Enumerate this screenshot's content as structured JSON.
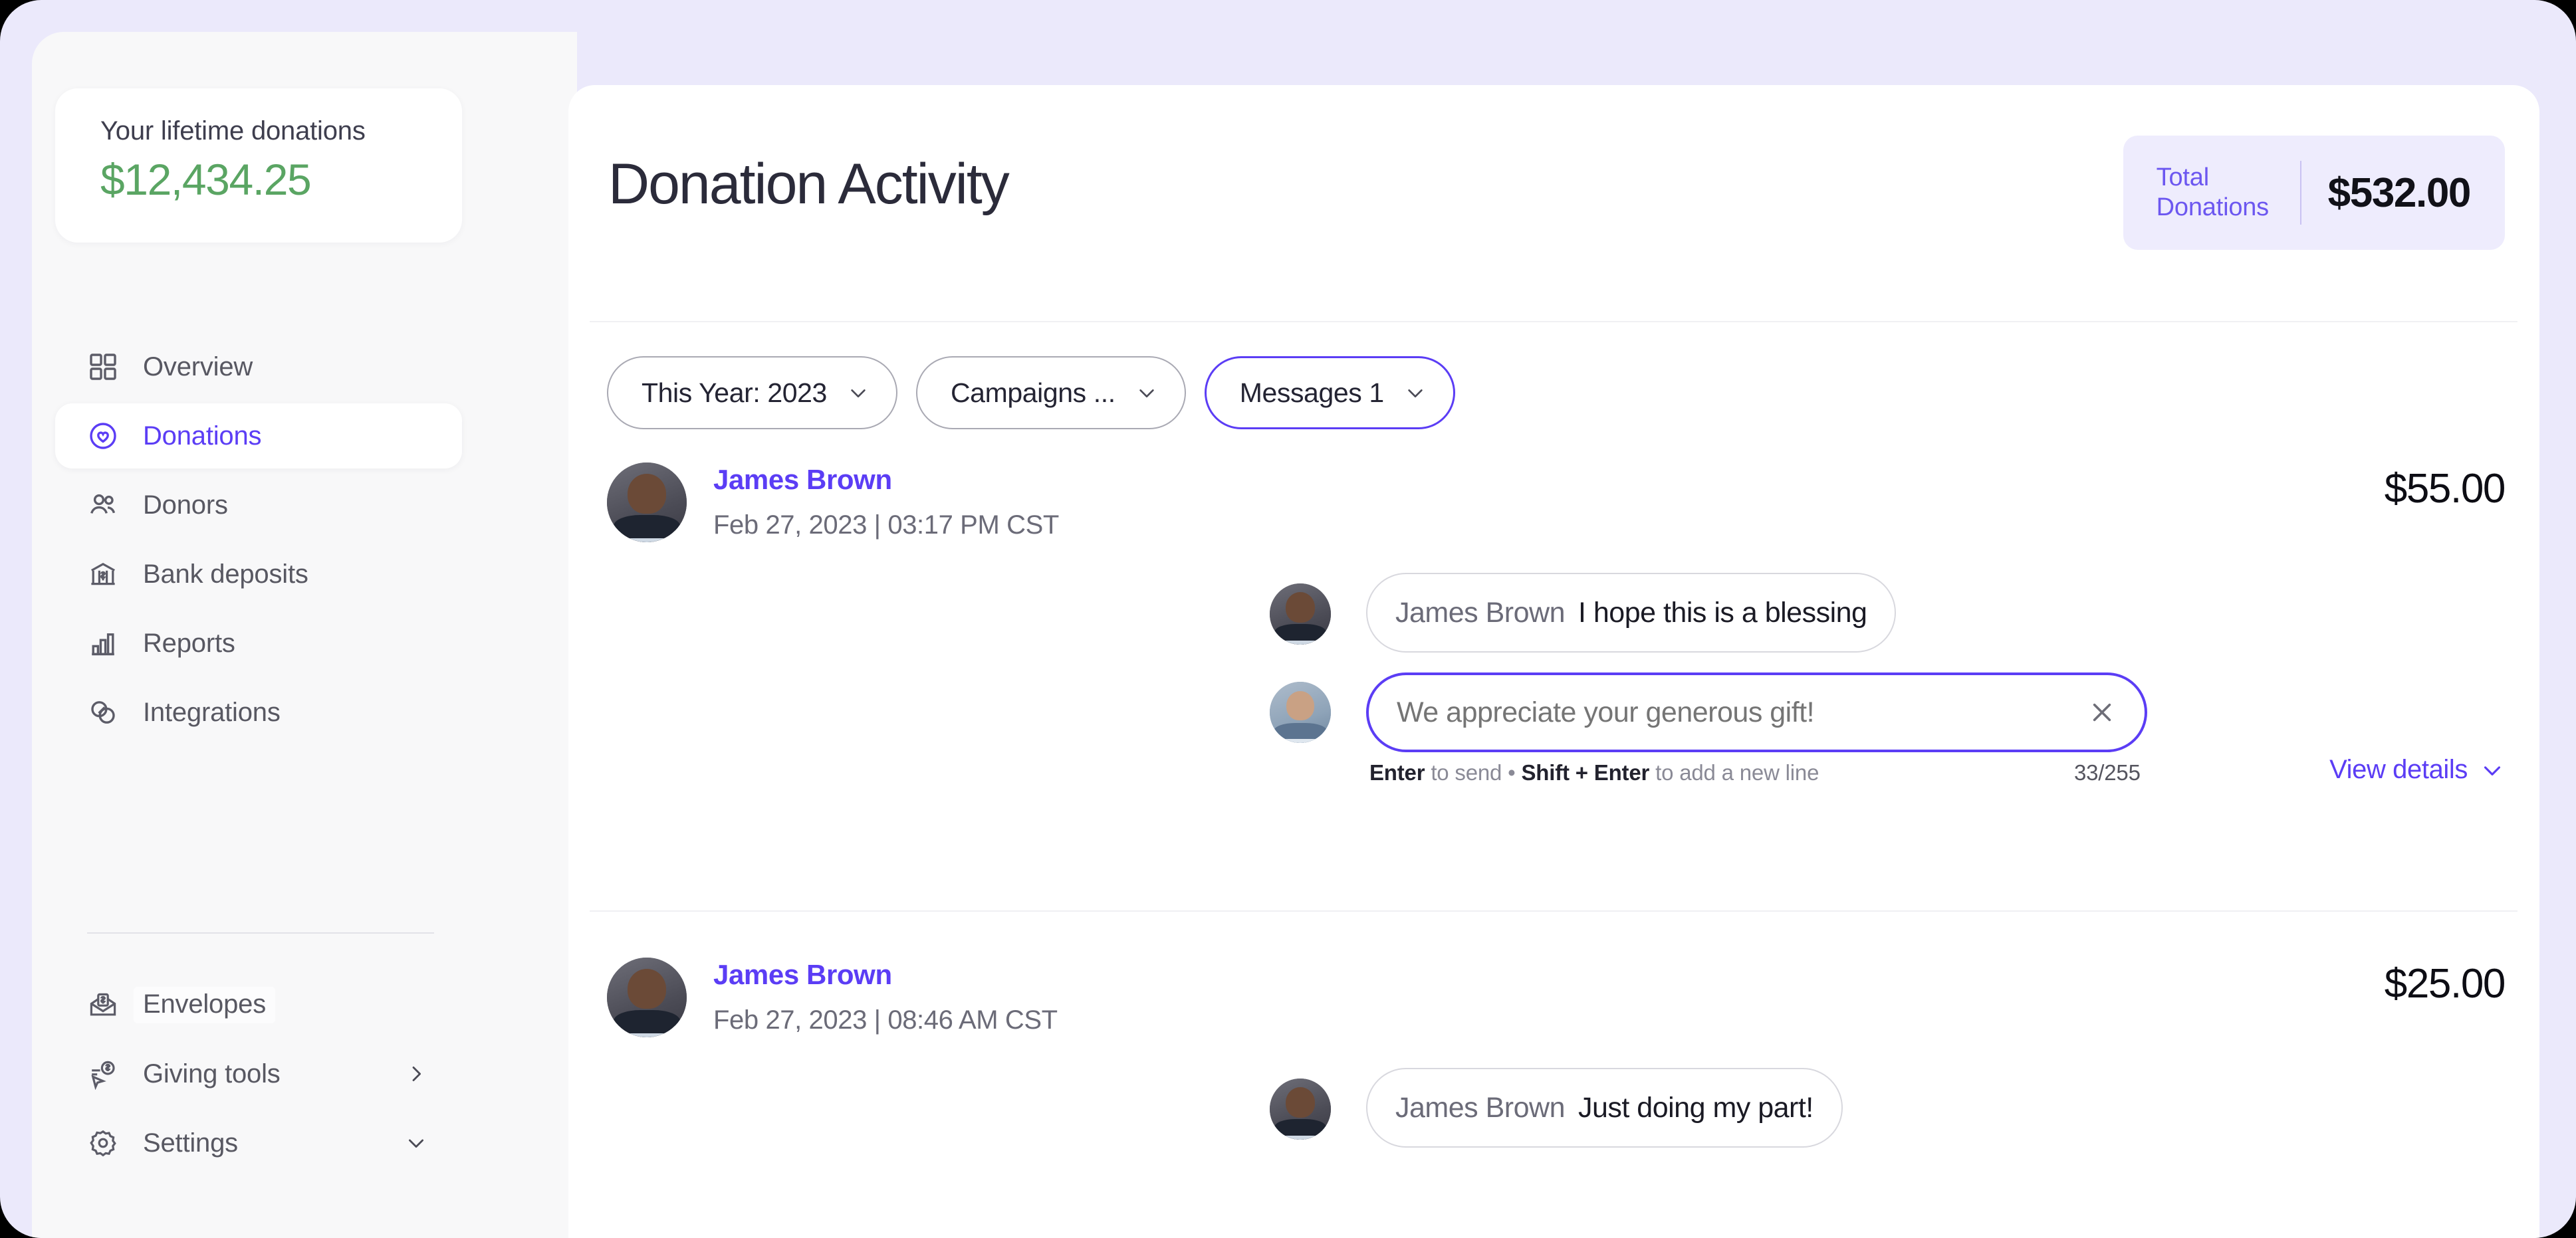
{
  "theme": {
    "accent_purple": "#5b3df5",
    "accent_purple_soft": "#eeecfd",
    "green": "#5aa563",
    "page_bg": "#ebe9fb",
    "sidebar_bg": "#f8f8f9",
    "card_bg": "#ffffff"
  },
  "sidebar": {
    "lifetime_card": {
      "label": "Your lifetime donations",
      "amount": "$12,434.25"
    },
    "items": [
      {
        "label": "Overview",
        "icon": "grid-icon",
        "active": false,
        "chevron": ""
      },
      {
        "label": "Donations",
        "icon": "heart-circle-icon",
        "active": true,
        "chevron": ""
      },
      {
        "label": "Donors",
        "icon": "users-icon",
        "active": false,
        "chevron": ""
      },
      {
        "label": "Bank deposits",
        "icon": "bank-icon",
        "active": false,
        "chevron": ""
      },
      {
        "label": "Reports",
        "icon": "bar-chart-icon",
        "active": false,
        "chevron": ""
      },
      {
        "label": "Integrations",
        "icon": "integrations-icon",
        "active": false,
        "chevron": ""
      }
    ],
    "items_lower": [
      {
        "label": "Envelopes",
        "icon": "envelope-dollar-icon",
        "active": false,
        "chevron": ""
      },
      {
        "label": "Giving tools",
        "icon": "giving-tools-icon",
        "active": false,
        "chevron": "chevron-right-icon"
      },
      {
        "label": "Settings",
        "icon": "gear-icon",
        "active": false,
        "chevron": "chevron-down-icon"
      }
    ]
  },
  "header": {
    "title": "Donation Activity",
    "total_badge": {
      "label_line1": "Total",
      "label_line2": "Donations",
      "amount": "$532.00"
    }
  },
  "filters": [
    {
      "label": "This Year: 2023",
      "active": false,
      "icon": "chevron-down-icon"
    },
    {
      "label": "Campaigns ...",
      "active": false,
      "icon": "chevron-down-icon"
    },
    {
      "label": "Messages 1",
      "active": true,
      "icon": "chevron-down-icon"
    }
  ],
  "donations": [
    {
      "donor_name": "James Brown",
      "timestamp": "Feb 27, 2023 | 03:17 PM CST",
      "amount": "$55.00",
      "avatar": "donor-avatar-dark",
      "message": {
        "author": "James Brown",
        "text": "I hope this is a blessing"
      },
      "reply": {
        "value": "We appreciate your generous gift!",
        "placeholder": "We appreciate your generous gift!",
        "clear_icon": "close-icon",
        "hint_enter": "Enter",
        "hint_to_send": " to send • ",
        "hint_shift": "Shift + Enter",
        "hint_newline": " to add a new line",
        "counter": "33/255",
        "avatar": "user-avatar-light"
      },
      "view_details_label": "View details",
      "view_details_icon": "chevron-down-icon"
    },
    {
      "donor_name": "James Brown",
      "timestamp": "Feb 27, 2023 | 08:46 AM CST",
      "amount": "$25.00",
      "avatar": "donor-avatar-dark",
      "message": {
        "author": "James Brown",
        "text": "Just doing my part!"
      }
    }
  ]
}
